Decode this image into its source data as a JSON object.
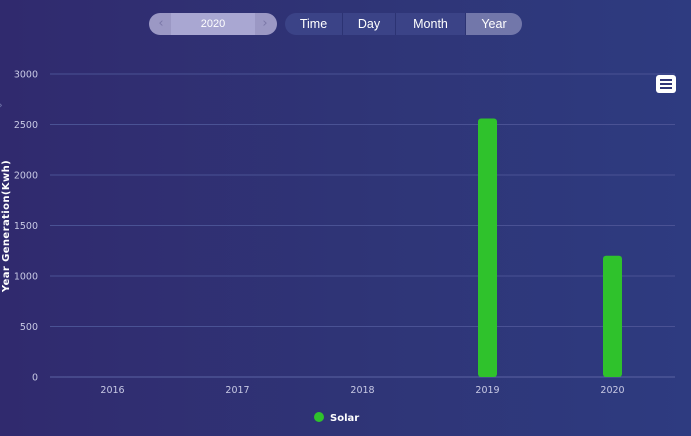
{
  "controls": {
    "year_value": "2020",
    "prev_icon": "chevron-left-icon",
    "next_icon": "chevron-right-icon",
    "tabs": [
      {
        "label": "Time",
        "active": false
      },
      {
        "label": "Day",
        "active": false
      },
      {
        "label": "Month",
        "active": false
      },
      {
        "label": "Year",
        "active": true
      }
    ],
    "menu_icon": "hamburger-menu-icon"
  },
  "colors": {
    "bar": "#2fc22c",
    "background_start": "#302a6e",
    "background_end": "#2e3b80",
    "active_tab": "#7277aa"
  },
  "chart_data": {
    "type": "bar",
    "title": "",
    "xlabel": "",
    "ylabel": "Year Generation(Kwh)",
    "categories": [
      "2016",
      "2017",
      "2018",
      "2019",
      "2020"
    ],
    "series": [
      {
        "name": "Solar",
        "values": [
          0,
          0,
          0,
          2560,
          1200
        ],
        "color": "#2fc22c"
      }
    ],
    "ylim": [
      0,
      3000
    ],
    "yticks": [
      0,
      500,
      1000,
      1500,
      2000,
      2500,
      3000
    ],
    "grid": true,
    "legend_position": "bottom"
  }
}
